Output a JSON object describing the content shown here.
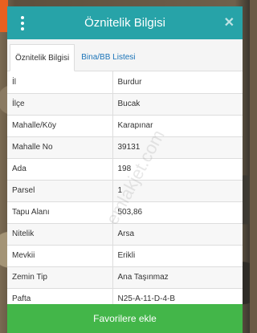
{
  "header": {
    "title": "Öznitelik Bilgisi",
    "close_glyph": "✕"
  },
  "tabs": [
    {
      "label": "Öznitelik Bilgisi",
      "active": true
    },
    {
      "label": "Bina/BB Listesi",
      "active": false
    }
  ],
  "attributes": [
    {
      "label": "İl",
      "value": "Burdur"
    },
    {
      "label": "İlçe",
      "value": "Bucak"
    },
    {
      "label": "Mahalle/Köy",
      "value": "Karapınar"
    },
    {
      "label": "Mahalle No",
      "value": "39131"
    },
    {
      "label": "Ada",
      "value": "198"
    },
    {
      "label": "Parsel",
      "value": "1"
    },
    {
      "label": "Tapu Alanı",
      "value": "503,86"
    },
    {
      "label": "Nitelik",
      "value": "Arsa"
    },
    {
      "label": "Mevkii",
      "value": "Erikli"
    },
    {
      "label": "Zemin Tip",
      "value": "Ana Taşınmaz"
    },
    {
      "label": "Pafta",
      "value": "N25-A-11-D-4-B"
    }
  ],
  "footer": {
    "button_label": "Favorilere ekle"
  },
  "watermark": "emlakjet.com",
  "colors": {
    "header": "#27a3a8",
    "tab_link": "#1a73b8",
    "footer_button": "#43b649",
    "accent_strip": "#e8601f"
  },
  "icons": {
    "menu": "kebab-menu-icon",
    "close": "close-icon"
  }
}
